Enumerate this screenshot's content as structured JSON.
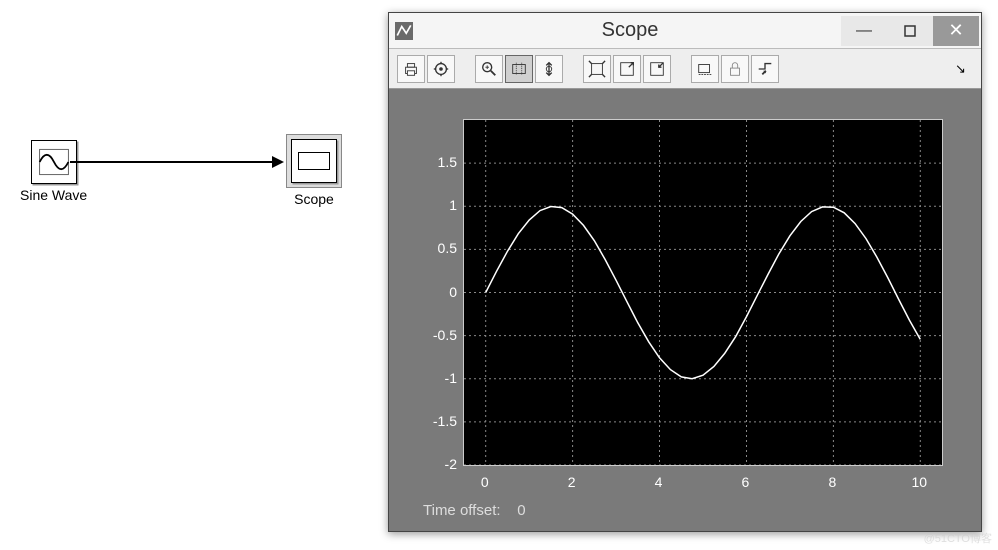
{
  "blocks": {
    "sinewave": {
      "label": "Sine Wave"
    },
    "scope": {
      "label": "Scope"
    }
  },
  "scope_window": {
    "title": "Scope",
    "toolbar": {
      "print": "print",
      "settings": "settings",
      "zoom_in": "zoom-in",
      "zoom_box": "zoom-box",
      "zoom_y": "zoom-y",
      "autoscale": "autoscale",
      "save_config": "save-config",
      "restore_config": "restore-config",
      "float": "float",
      "lock": "lock",
      "signal_select": "signal-select"
    },
    "time_offset_label": "Time offset:",
    "time_offset_value": "0"
  },
  "chart_data": {
    "type": "line",
    "title": "",
    "xlabel": "",
    "ylabel": "",
    "xlim": [
      -0.5,
      10.5
    ],
    "ylim": [
      -2,
      2
    ],
    "xticks": [
      0,
      2,
      4,
      6,
      8,
      10
    ],
    "yticks": [
      -2,
      -1.5,
      -1,
      -0.5,
      0,
      0.5,
      1,
      1.5
    ],
    "x": [
      0,
      0.25,
      0.5,
      0.75,
      1,
      1.25,
      1.5,
      1.75,
      2,
      2.25,
      2.5,
      2.75,
      3,
      3.25,
      3.5,
      3.75,
      4,
      4.25,
      4.5,
      4.75,
      5,
      5.25,
      5.5,
      5.75,
      6,
      6.25,
      6.5,
      6.75,
      7,
      7.25,
      7.5,
      7.75,
      8,
      8.25,
      8.5,
      8.75,
      9,
      9.25,
      9.5,
      9.75,
      10
    ],
    "values": [
      0,
      0.247,
      0.479,
      0.682,
      0.841,
      0.949,
      0.997,
      0.984,
      0.909,
      0.778,
      0.599,
      0.382,
      0.141,
      -0.108,
      -0.351,
      -0.572,
      -0.757,
      -0.894,
      -0.978,
      -0.999,
      -0.959,
      -0.858,
      -0.706,
      -0.512,
      -0.279,
      -0.033,
      0.215,
      0.45,
      0.657,
      0.823,
      0.938,
      0.993,
      0.989,
      0.924,
      0.799,
      0.625,
      0.412,
      0.174,
      -0.075,
      -0.32,
      -0.544
    ]
  },
  "watermark": "@51CTO博客"
}
